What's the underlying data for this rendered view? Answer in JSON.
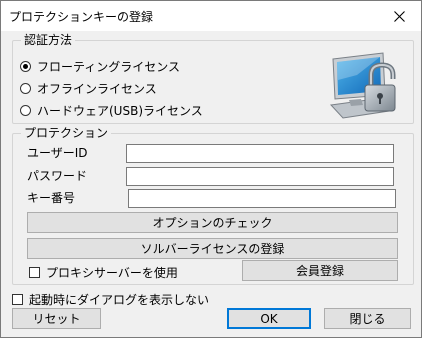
{
  "window": {
    "title": "プロテクションキーの登録",
    "close_icon": "close-icon"
  },
  "auth_group": {
    "legend": "認証方法",
    "options": [
      {
        "label": "フローティングライセンス",
        "selected": true
      },
      {
        "label": "オフラインライセンス",
        "selected": false
      },
      {
        "label": "ハードウェア(USB)ライセンス",
        "selected": false
      }
    ],
    "image_icon": "computer-lock-icon"
  },
  "protection_group": {
    "legend": "プロテクション",
    "user_id_label": "ユーザーID",
    "user_id_value": "",
    "password_label": "パスワード",
    "password_value": "",
    "key_number_label": "キー番号",
    "key_number_value": "",
    "check_options_button": "オプションのチェック",
    "register_solver_button": "ソルバーライセンスの登録",
    "proxy_checkbox_label": "プロキシサーバーを使用",
    "proxy_checked": false,
    "member_register_button": "会員登録"
  },
  "startup_checkbox_label": "起動時にダイアログを表示しない",
  "startup_checked": false,
  "buttons": {
    "reset": "リセット",
    "ok": "OK",
    "close": "閉じる"
  }
}
